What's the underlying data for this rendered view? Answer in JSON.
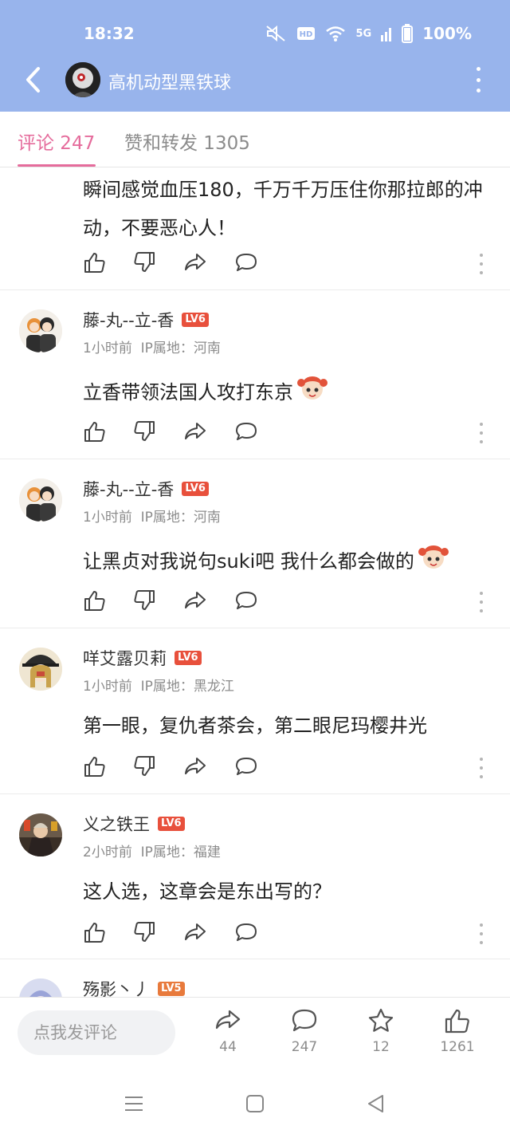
{
  "status_bar": {
    "time": "18:32",
    "network": "5G",
    "battery": "100%"
  },
  "header": {
    "title": "高机动型黑铁球",
    "colors": {
      "background": "#98b4ec"
    }
  },
  "tabs": [
    {
      "label": "评论 247",
      "active": true
    },
    {
      "label": "赞和转发 1305",
      "active": false
    }
  ],
  "accent_color": "#e56c9c",
  "comments": [
    {
      "text": "瞬间感觉血压180，千万千万压住你那拉郎的冲动，不要恶心人！"
    },
    {
      "user": "藤-丸--立-香",
      "level": "LV6",
      "time": "1小时前",
      "location": "IP属地：河南",
      "text": "立香带领法国人攻打东京"
    },
    {
      "user": "藤-丸--立-香",
      "level": "LV6",
      "time": "1小时前",
      "location": "IP属地：河南",
      "text": "让黑贞对我说句suki吧 我什么都会做的"
    },
    {
      "user": "咩艾露贝莉",
      "level": "LV6",
      "time": "1小时前",
      "location": "IP属地：黑龙江",
      "text": "第一眼，复仇者茶会，第二眼尼玛樱井光"
    },
    {
      "user": "义之铁王",
      "level": "LV6",
      "time": "2小时前",
      "location": "IP属地：福建",
      "text": "这人选，这章会是东出写的？"
    },
    {
      "user": "殇影丶丿",
      "level": "LV5"
    }
  ],
  "bottom_bar": {
    "input_placeholder": "点我发评论",
    "repost_count": "44",
    "comment_count": "247",
    "favorite_count": "12",
    "like_count": "1261"
  }
}
